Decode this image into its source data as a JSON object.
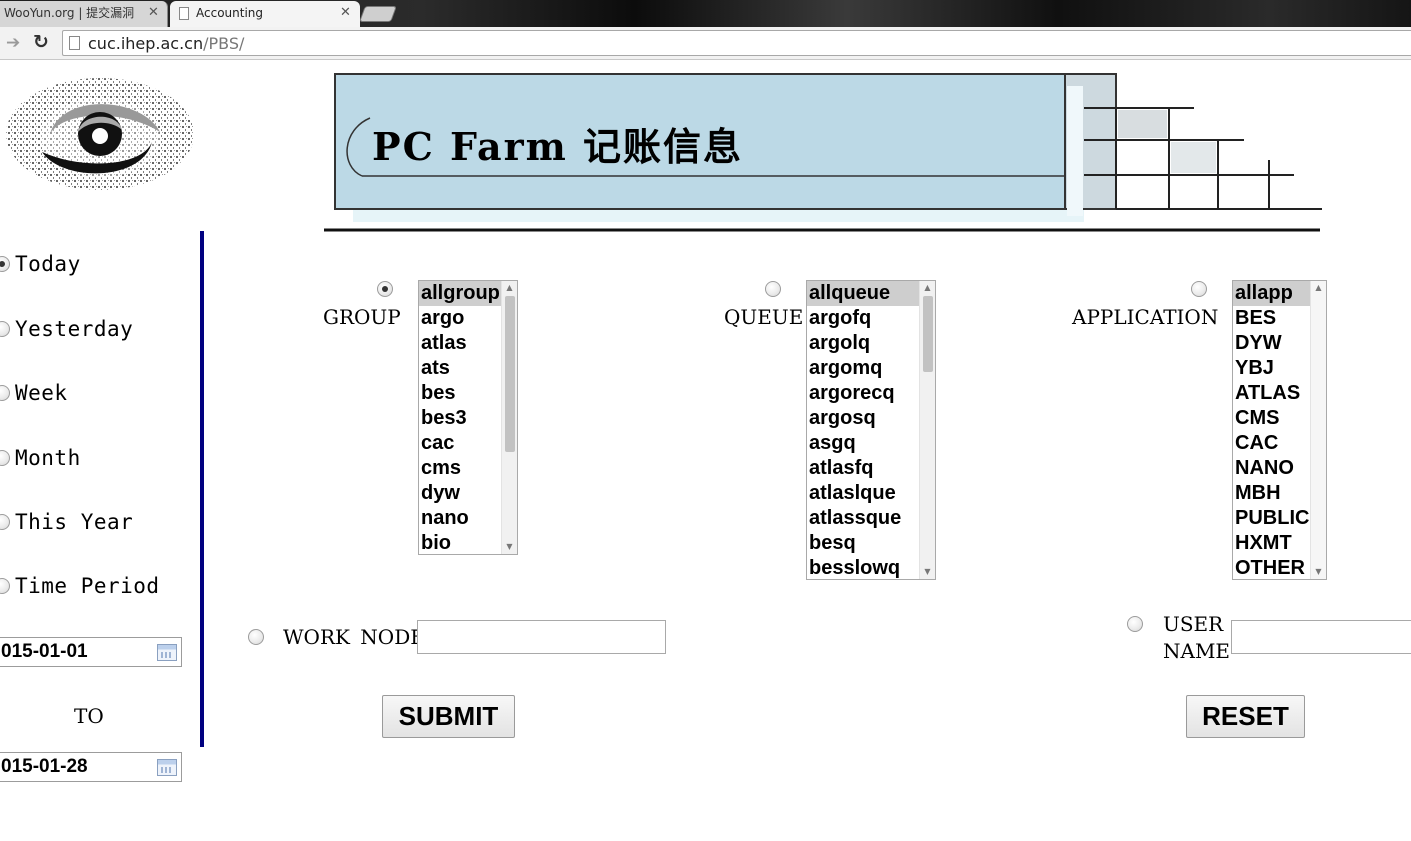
{
  "browser": {
    "tabs": [
      {
        "title": "WooYun.org | 提交漏洞"
      },
      {
        "title": "Accounting"
      }
    ],
    "close_glyph": "✕",
    "url_host": "cuc.ihep.ac.cn",
    "url_path": "/PBS/"
  },
  "banner": {
    "title": "PC Farm 记账信息"
  },
  "period": {
    "options": [
      "Today",
      "Yesterday",
      "Week",
      "Month",
      "This Year",
      "Time Period"
    ],
    "selected": "Today",
    "from_date": "015-01-01",
    "to_label": "TO",
    "to_date": "015-01-28"
  },
  "group": {
    "label": "GROUP",
    "items": [
      "allgroup",
      "argo",
      "atlas",
      "ats",
      "bes",
      "bes3",
      "cac",
      "cms",
      "dyw",
      "nano",
      "bio"
    ],
    "selected": "allgroup"
  },
  "queue": {
    "label": "QUEUE",
    "items": [
      "allqueue",
      "argofq",
      "argolq",
      "argomq",
      "argorecq",
      "argosq",
      "asgq",
      "atlasfq",
      "atlaslque",
      "atlassque",
      "besq",
      "besslowq"
    ],
    "selected": "allqueue"
  },
  "application": {
    "label": "APPLICATION",
    "items": [
      "allapp",
      "BES",
      "DYW",
      "YBJ",
      "ATLAS",
      "CMS",
      "CAC",
      "NANO",
      "MBH",
      "PUBLIC",
      "HXMT",
      "OTHER"
    ],
    "selected": "allapp"
  },
  "work_node": {
    "label": "WORK NODE",
    "value": ""
  },
  "user_name": {
    "label_line1": "USER",
    "label_line2": "NAME",
    "value": ""
  },
  "buttons": {
    "submit": "SUBMIT",
    "reset": "RESET"
  },
  "selected_filter": "group",
  "colors": {
    "sidebar_rule": "#000080",
    "banner_panel": "#bcd9e6",
    "list_selection": "#cecece"
  }
}
